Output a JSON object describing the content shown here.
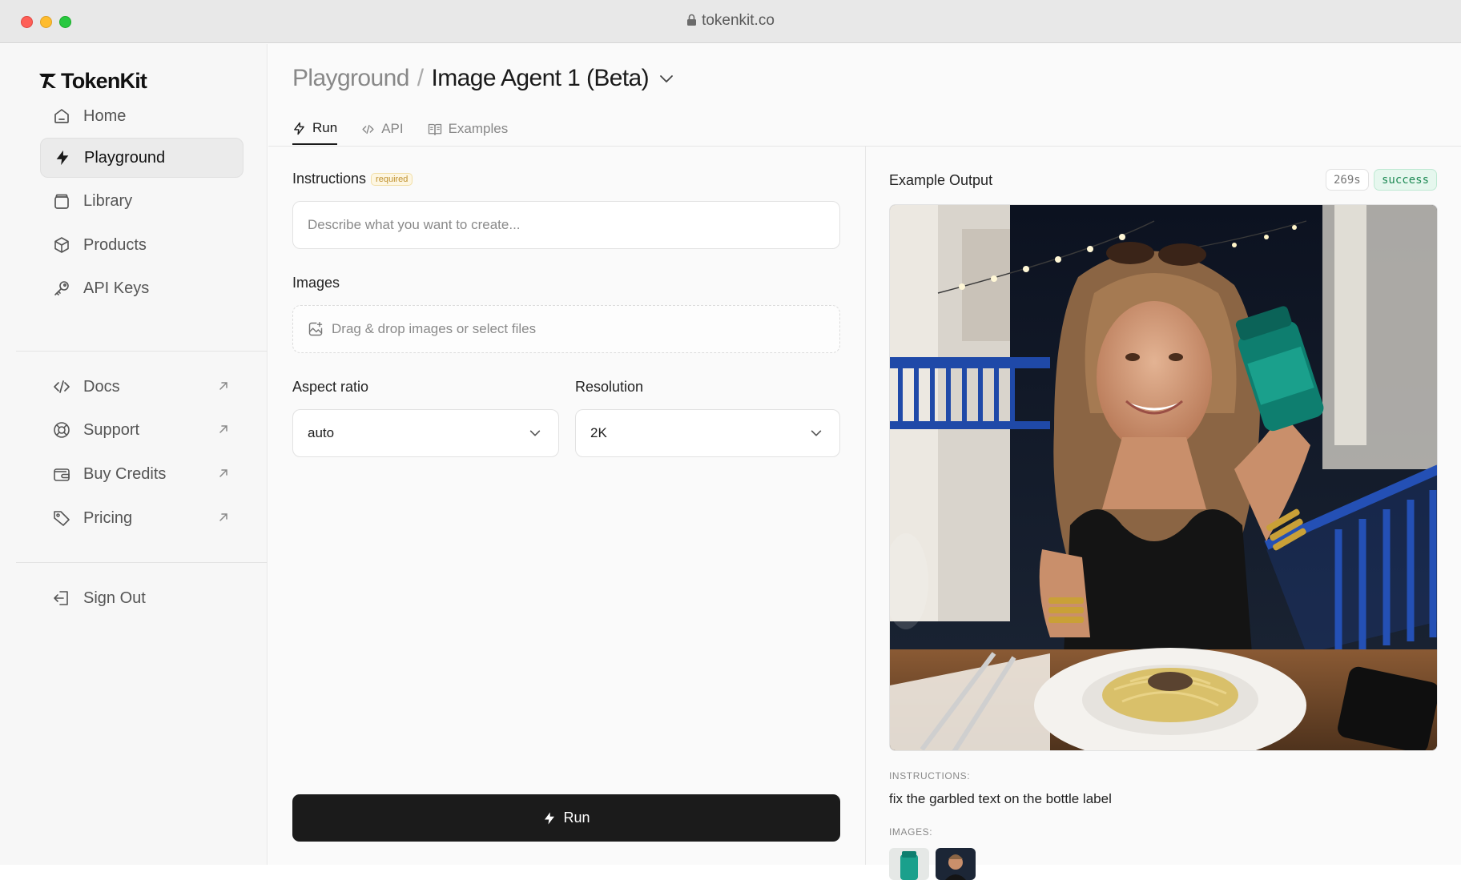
{
  "browser": {
    "url": "tokenkit.co"
  },
  "sidebar": {
    "logo": "TokenKit",
    "items": [
      {
        "label": "Home",
        "icon": "home-icon"
      },
      {
        "label": "Playground",
        "icon": "bolt-icon",
        "active": true
      },
      {
        "label": "Library",
        "icon": "library-icon"
      },
      {
        "label": "Products",
        "icon": "box-icon"
      },
      {
        "label": "API Keys",
        "icon": "key-icon"
      }
    ],
    "external": [
      {
        "label": "Docs",
        "icon": "code-icon"
      },
      {
        "label": "Support",
        "icon": "lifebuoy-icon"
      },
      {
        "label": "Buy Credits",
        "icon": "wallet-icon"
      },
      {
        "label": "Pricing",
        "icon": "tag-icon"
      }
    ],
    "signout": {
      "label": "Sign Out",
      "icon": "sign-out-icon"
    }
  },
  "header": {
    "breadcrumb_parent": "Playground",
    "breadcrumb_separator": "/",
    "title": "Image Agent 1 (Beta)"
  },
  "tabs": [
    {
      "label": "Run",
      "icon": "bolt-icon",
      "active": true
    },
    {
      "label": "API",
      "icon": "code-icon"
    },
    {
      "label": "Examples",
      "icon": "book-icon"
    }
  ],
  "form": {
    "instructions_label": "Instructions",
    "required_badge": "required",
    "instructions_placeholder": "Describe what you want to create...",
    "images_label": "Images",
    "images_dropzone": "Drag & drop images or select files",
    "aspect_label": "Aspect ratio",
    "aspect_value": "auto",
    "resolution_label": "Resolution",
    "resolution_value": "2K",
    "run_label": "Run"
  },
  "output": {
    "title": "Example Output",
    "duration": "269s",
    "status": "success",
    "instructions_heading": "INSTRUCTIONS:",
    "instructions_text": "fix the garbled text on the bottle label",
    "images_heading": "IMAGES:"
  },
  "colors": {
    "accent": "#1b1b1b",
    "success": "#1f8a55",
    "required": "#c09230"
  }
}
